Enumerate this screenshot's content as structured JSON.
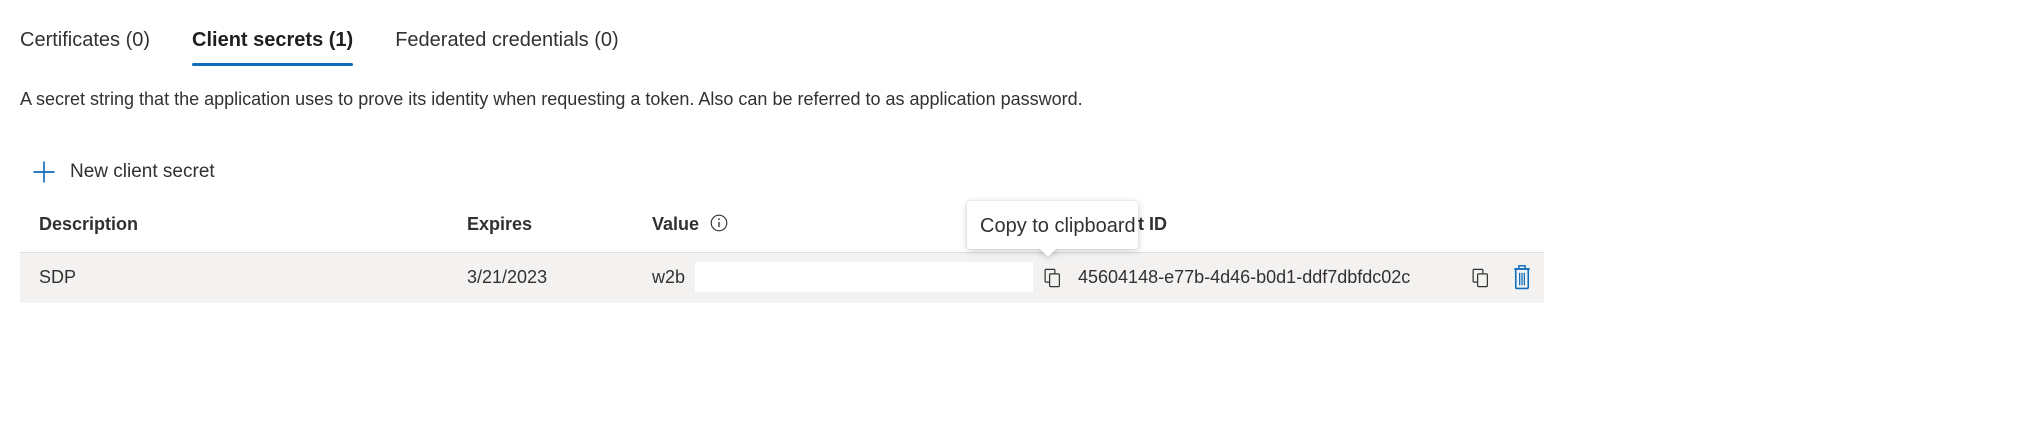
{
  "tabs": [
    {
      "label": "Certificates (0)",
      "active": false
    },
    {
      "label": "Client secrets (1)",
      "active": true
    },
    {
      "label": "Federated credentials (0)",
      "active": false
    }
  ],
  "description": "A secret string that the application uses to prove its identity when requesting a token. Also can be referred to as application password.",
  "toolbar": {
    "new_secret_label": "New client secret",
    "new_secret_icon": "plus-icon"
  },
  "table": {
    "columns": {
      "description": "Description",
      "expires": "Expires",
      "value": "Value",
      "secret_id_visible": "et ID"
    },
    "rows": [
      {
        "description": "SDP",
        "expires": "3/21/2023",
        "value_visible": "w2b",
        "secret_id": "45604148-e77b-4d46-b0d1-ddf7dbfdc02c"
      }
    ]
  },
  "tooltip": {
    "text": "Copy to clipboard"
  },
  "colors": {
    "accent": "#0f6cbd",
    "delete": "#0f6cbd",
    "row_background": "#f3f2f1",
    "text": "#323130"
  }
}
